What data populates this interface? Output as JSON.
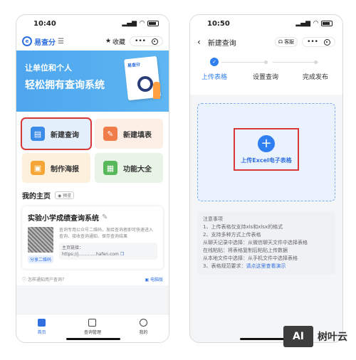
{
  "left": {
    "status_time": "10:40",
    "logo_text": "易查分",
    "fav_label": "收藏",
    "banner_line1": "让单位和个人",
    "banner_line2": "轻松拥有查询系统",
    "tiles": [
      {
        "label": "新建查询",
        "icon": "new-query-icon"
      },
      {
        "label": "新建填表",
        "icon": "new-form-icon"
      },
      {
        "label": "制作海报",
        "icon": "poster-icon"
      },
      {
        "label": "功能大全",
        "icon": "features-icon"
      }
    ],
    "home_title": "我的主页",
    "preview_label": "预览",
    "card_title": "实验小学成绩查询系统",
    "card_desc": "查询专用公众号二维码，发给查询者即可快速进入查询、接收查询通知、保存查询结果",
    "share_label": "分享二维码",
    "home_link_label": "主页链接：",
    "home_link_value": "https://j.............hafen.com",
    "notify_text": "怎样通知用户查询？",
    "pc_label": "电脑版",
    "tabs": [
      {
        "label": "首页"
      },
      {
        "label": "查询管理"
      },
      {
        "label": "我的"
      }
    ]
  },
  "right": {
    "status_time": "10:50",
    "title": "新建查询",
    "service_label": "客服",
    "steps": [
      {
        "label": "上传表格"
      },
      {
        "label": "设置查询"
      },
      {
        "label": "完成发布"
      }
    ],
    "upload_label": "上传Excel电子表格",
    "notes_title": "注意事项",
    "notes": [
      "1、上传表格仅支持xls和xlsx的格式",
      "2、支持多种方式上传表格",
      "从聊天记录中选择：从微信聊天文件中选择表格",
      "在线粘贴：将表格复制后粘贴上传数据",
      "从本地文件中选择：从手机文件中选择表格"
    ],
    "note3_prefix": "3、表格规范要求：",
    "note3_link": "请点这里查看演示"
  },
  "watermark": {
    "box": "AI",
    "text": "树叶云"
  },
  "colors": {
    "accent": "#2f7ff0",
    "highlight": "#d9393a"
  }
}
